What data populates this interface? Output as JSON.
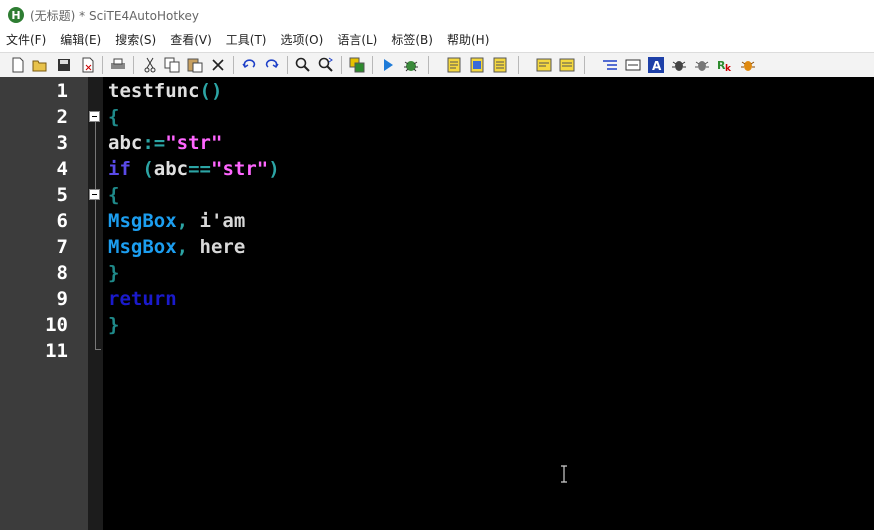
{
  "window": {
    "title": "(无标题) * SciTE4AutoHotkey",
    "app_icon_letter": "H"
  },
  "menu": [
    {
      "label": "文件(F)"
    },
    {
      "label": "编辑(E)"
    },
    {
      "label": "搜索(S)"
    },
    {
      "label": "查看(V)"
    },
    {
      "label": "工具(T)"
    },
    {
      "label": "选项(O)"
    },
    {
      "label": "语言(L)"
    },
    {
      "label": "标签(B)"
    },
    {
      "label": "帮助(H)"
    }
  ],
  "toolbar_icons": [
    "new-file-icon",
    "open-folder-icon",
    "save-icon",
    "close-file-icon",
    "print-icon",
    "cut-icon",
    "copy-icon",
    "paste-icon",
    "delete-icon",
    "undo-icon",
    "redo-icon",
    "find-icon",
    "replace-icon",
    "macro-icon",
    "run-icon",
    "debug-icon",
    "script-info-icon",
    "script-compile-icon",
    "script-window-icon",
    "bookmark-icon",
    "bookmark-list-icon",
    "window-spy-icon",
    "textbox-icon",
    "font-icon",
    "debug-bug-icon",
    "debug-bug2-icon",
    "rk-icon",
    "bug-orange-icon"
  ],
  "editor": {
    "lines": [
      {
        "number": "1",
        "tokens": [
          {
            "t": "testfunc",
            "c": "fn"
          },
          {
            "t": "()",
            "c": "op"
          }
        ]
      },
      {
        "number": "2",
        "tokens": [
          {
            "t": "{",
            "c": "brace"
          }
        ]
      },
      {
        "number": "3",
        "tokens": [
          {
            "t": "abc",
            "c": "fn"
          },
          {
            "t": ":=",
            "c": "op"
          },
          {
            "t": "\"str\"",
            "c": "str"
          }
        ]
      },
      {
        "number": "4",
        "tokens": [
          {
            "t": "if",
            "c": "kw"
          },
          {
            "t": " (",
            "c": "op"
          },
          {
            "t": "abc",
            "c": "fn"
          },
          {
            "t": "==",
            "c": "op"
          },
          {
            "t": "\"str\"",
            "c": "str"
          },
          {
            "t": ")",
            "c": "op"
          }
        ]
      },
      {
        "number": "5",
        "tokens": [
          {
            "t": "{",
            "c": "brace"
          }
        ]
      },
      {
        "number": "6",
        "tokens": [
          {
            "t": "MsgBox",
            "c": "cmd"
          },
          {
            "t": ", ",
            "c": "op"
          },
          {
            "t": "i'am",
            "c": "txt"
          }
        ]
      },
      {
        "number": "7",
        "tokens": [
          {
            "t": "MsgBox",
            "c": "cmd"
          },
          {
            "t": ", ",
            "c": "op"
          },
          {
            "t": "here",
            "c": "txt"
          }
        ]
      },
      {
        "number": "8",
        "tokens": [
          {
            "t": "}",
            "c": "brace"
          }
        ]
      },
      {
        "number": "9",
        "tokens": [
          {
            "t": "return",
            "c": "kw2"
          }
        ]
      },
      {
        "number": "10",
        "tokens": [
          {
            "t": "}",
            "c": "brace"
          }
        ]
      },
      {
        "number": "11",
        "tokens": []
      }
    ]
  }
}
